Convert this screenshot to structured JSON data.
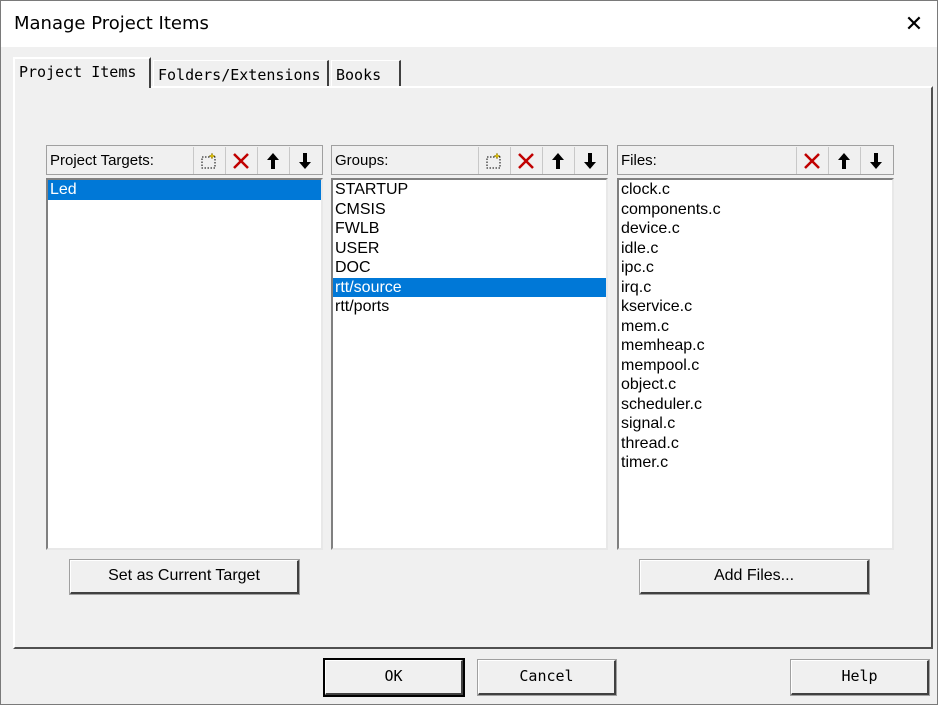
{
  "window": {
    "title": "Manage Project Items",
    "close_glyph": "✕"
  },
  "tabs": [
    {
      "label": "Project Items",
      "active": true
    },
    {
      "label": "Folders/Extensions",
      "active": false
    },
    {
      "label": "Books",
      "active": false
    }
  ],
  "targets": {
    "label": "Project Targets:",
    "items": [
      "Led"
    ],
    "selected_index": 0,
    "button_label": "Set as Current Target"
  },
  "groups": {
    "label": "Groups:",
    "items": [
      "STARTUP",
      "CMSIS",
      "FWLB",
      "USER",
      "DOC",
      "rtt/source",
      "rtt/ports"
    ],
    "selected_index": 5
  },
  "files": {
    "label": "Files:",
    "items": [
      "clock.c",
      "components.c",
      "device.c",
      "idle.c",
      "ipc.c",
      "irq.c",
      "kservice.c",
      "mem.c",
      "memheap.c",
      "mempool.c",
      "object.c",
      "scheduler.c",
      "signal.c",
      "thread.c",
      "timer.c"
    ],
    "button_label": "Add Files..."
  },
  "toolbar_icons": {
    "new": "new-item-icon",
    "delete": "delete-icon",
    "up": "move-up-icon",
    "down": "move-down-icon",
    "delete_color": "#c00000"
  },
  "dialog_buttons": {
    "ok": "OK",
    "cancel": "Cancel",
    "help": "Help"
  },
  "colors": {
    "selection": "#0078d7"
  }
}
